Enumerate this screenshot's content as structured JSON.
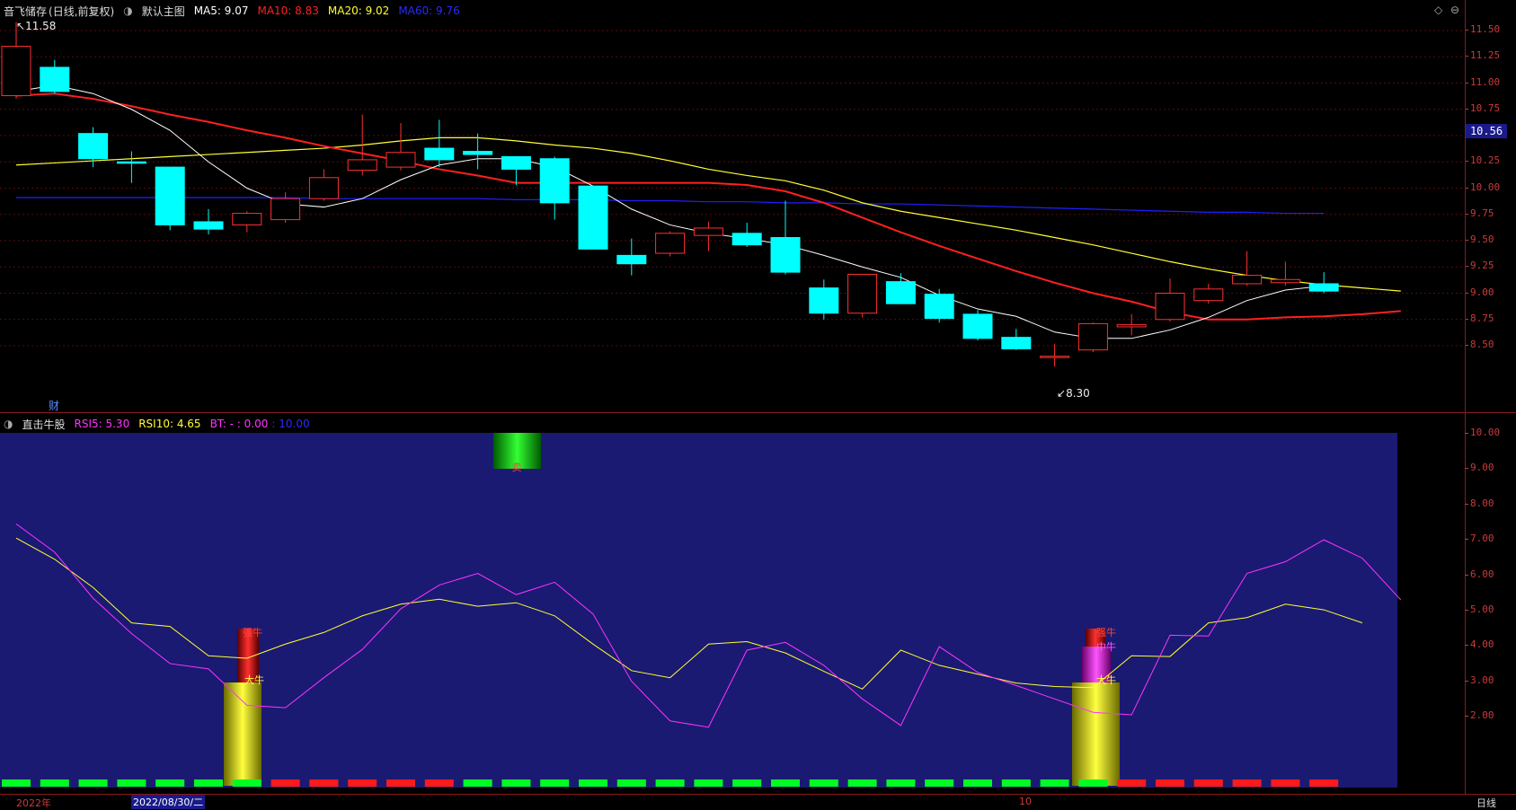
{
  "main": {
    "stock_name": "音飞储存",
    "period_mode": "(日线,前复权)",
    "chart_mode": "默认主图",
    "ma5": {
      "label": "MA5: 9.07",
      "color": "#ffffff"
    },
    "ma10": {
      "label": "MA10: 8.83",
      "color": "#ff2020"
    },
    "ma20": {
      "label": "MA20: 9.02",
      "color": "#ffff33"
    },
    "ma60": {
      "label": "MA60: 9.76",
      "color": "#2020ff"
    },
    "high_label": "11.58",
    "low_label": "8.30",
    "current_price": "10.56",
    "finance_marker": "财",
    "price_ticks": [
      "11.50",
      "11.25",
      "11.00",
      "10.75",
      "10.50",
      "10.25",
      "10.00",
      "9.75",
      "9.50",
      "9.25",
      "9.00",
      "8.75",
      "8.50"
    ]
  },
  "indicator": {
    "name": "直击牛股",
    "rsi5": {
      "label": "RSI5: 5.30",
      "color": "#ff33ff"
    },
    "rsi10": {
      "label": "RSI10: 4.65",
      "color": "#ffff33"
    },
    "bt": {
      "label": "BT: - : 0.00",
      "color": "#ff33ff"
    },
    "extra": {
      "label": ": 10.00",
      "color": "#2020ff"
    },
    "ticks": [
      "10.00",
      "9.00",
      "8.00",
      "7.00",
      "6.00",
      "5.00",
      "4.00",
      "3.00",
      "2.00"
    ],
    "signal_labels": {
      "sell": "卖",
      "strong": "强牛",
      "big": "大牛",
      "mid": "中牛"
    }
  },
  "bottom": {
    "year_label": "2022年",
    "cursor_date": "2022/08/30/二",
    "month_label": "10",
    "period_button": "日线"
  },
  "chart_data": {
    "type": "candlestick",
    "ylim": [
      8.3,
      11.6
    ],
    "candles": [
      {
        "o": 10.88,
        "h": 11.58,
        "l": 10.85,
        "c": 11.35
      },
      {
        "o": 11.15,
        "h": 11.22,
        "l": 10.9,
        "c": 10.92
      },
      {
        "o": 10.52,
        "h": 10.58,
        "l": 10.2,
        "c": 10.28
      },
      {
        "o": 10.25,
        "h": 10.35,
        "l": 10.05,
        "c": 10.24
      },
      {
        "o": 10.2,
        "h": 10.2,
        "l": 9.6,
        "c": 9.65
      },
      {
        "o": 9.68,
        "h": 9.8,
        "l": 9.56,
        "c": 9.61
      },
      {
        "o": 9.65,
        "h": 9.78,
        "l": 9.58,
        "c": 9.76
      },
      {
        "o": 9.7,
        "h": 9.96,
        "l": 9.67,
        "c": 9.9
      },
      {
        "o": 9.9,
        "h": 10.18,
        "l": 9.88,
        "c": 10.1
      },
      {
        "o": 10.17,
        "h": 10.7,
        "l": 10.12,
        "c": 10.27
      },
      {
        "o": 10.2,
        "h": 10.62,
        "l": 10.17,
        "c": 10.34
      },
      {
        "o": 10.38,
        "h": 10.65,
        "l": 10.2,
        "c": 10.27
      },
      {
        "o": 10.35,
        "h": 10.52,
        "l": 10.18,
        "c": 10.32
      },
      {
        "o": 10.3,
        "h": 10.3,
        "l": 10.03,
        "c": 10.18
      },
      {
        "o": 10.28,
        "h": 10.3,
        "l": 9.7,
        "c": 9.86
      },
      {
        "o": 10.02,
        "h": 10.02,
        "l": 9.42,
        "c": 9.42
      },
      {
        "o": 9.36,
        "h": 9.52,
        "l": 9.17,
        "c": 9.28
      },
      {
        "o": 9.38,
        "h": 9.59,
        "l": 9.35,
        "c": 9.57
      },
      {
        "o": 9.55,
        "h": 9.68,
        "l": 9.4,
        "c": 9.62
      },
      {
        "o": 9.57,
        "h": 9.67,
        "l": 9.44,
        "c": 9.46
      },
      {
        "o": 9.53,
        "h": 9.88,
        "l": 9.18,
        "c": 9.2
      },
      {
        "o": 9.05,
        "h": 9.13,
        "l": 8.75,
        "c": 8.81
      },
      {
        "o": 8.81,
        "h": 9.18,
        "l": 8.77,
        "c": 9.18
      },
      {
        "o": 9.11,
        "h": 9.19,
        "l": 8.9,
        "c": 8.9
      },
      {
        "o": 8.99,
        "h": 9.04,
        "l": 8.72,
        "c": 8.76
      },
      {
        "o": 8.8,
        "h": 8.84,
        "l": 8.55,
        "c": 8.57
      },
      {
        "o": 8.58,
        "h": 8.66,
        "l": 8.46,
        "c": 8.47
      },
      {
        "o": 8.4,
        "h": 8.52,
        "l": 8.3,
        "c": 8.4
      },
      {
        "o": 8.46,
        "h": 8.72,
        "l": 8.44,
        "c": 8.71
      },
      {
        "o": 8.68,
        "h": 8.8,
        "l": 8.6,
        "c": 8.7
      },
      {
        "o": 8.75,
        "h": 9.14,
        "l": 8.73,
        "c": 9.0
      },
      {
        "o": 8.93,
        "h": 9.09,
        "l": 8.9,
        "c": 9.04
      },
      {
        "o": 9.09,
        "h": 9.4,
        "l": 9.07,
        "c": 9.17
      },
      {
        "o": 9.1,
        "h": 9.3,
        "l": 9.07,
        "c": 9.13
      },
      {
        "o": 9.09,
        "h": 9.2,
        "l": 9.0,
        "c": 9.02
      }
    ],
    "ma5": [
      10.92,
      10.98,
      10.9,
      10.75,
      10.55,
      10.25,
      10.0,
      9.85,
      9.82,
      9.9,
      10.08,
      10.22,
      10.28,
      10.28,
      10.2,
      10.02,
      9.8,
      9.65,
      9.57,
      9.52,
      9.46,
      9.36,
      9.25,
      9.15,
      8.98,
      8.85,
      8.78,
      8.63,
      8.57,
      8.57,
      8.65,
      8.77,
      8.93,
      9.03,
      9.07
    ],
    "ma10": [
      10.88,
      10.9,
      10.85,
      10.78,
      10.7,
      10.63,
      10.55,
      10.48,
      10.4,
      10.33,
      10.26,
      10.18,
      10.12,
      10.05,
      10.05,
      10.05,
      10.05,
      10.05,
      10.05,
      10.03,
      9.97,
      9.86,
      9.72,
      9.58,
      9.45,
      9.33,
      9.21,
      9.1,
      9.0,
      8.92,
      8.82,
      8.75,
      8.75,
      8.77,
      8.78,
      8.8,
      8.83
    ],
    "ma20": [
      10.22,
      10.24,
      10.26,
      10.28,
      10.3,
      10.32,
      10.34,
      10.36,
      10.38,
      10.41,
      10.45,
      10.48,
      10.48,
      10.45,
      10.41,
      10.38,
      10.33,
      10.26,
      10.18,
      10.12,
      10.07,
      9.98,
      9.86,
      9.78,
      9.72,
      9.66,
      9.6,
      9.53,
      9.46,
      9.38,
      9.3,
      9.23,
      9.17,
      9.12,
      9.08,
      9.05,
      9.02
    ],
    "ma60": [
      9.91,
      9.91,
      9.91,
      9.91,
      9.91,
      9.91,
      9.91,
      9.91,
      9.9,
      9.9,
      9.9,
      9.9,
      9.9,
      9.89,
      9.89,
      9.89,
      9.88,
      9.88,
      9.87,
      9.87,
      9.86,
      9.86,
      9.85,
      9.85,
      9.84,
      9.83,
      9.82,
      9.81,
      9.8,
      9.79,
      9.78,
      9.77,
      9.77,
      9.76,
      9.76
    ],
    "rsi_ylim": [
      1.4,
      10.5
    ],
    "rsi5": [
      7.45,
      6.65,
      5.35,
      4.35,
      3.5,
      3.35,
      2.32,
      2.25,
      3.1,
      3.9,
      5.05,
      5.72,
      6.05,
      5.45,
      5.8,
      4.9,
      3.0,
      1.88,
      1.7,
      3.88,
      4.1,
      3.45,
      2.5,
      1.75,
      3.98,
      3.25,
      2.88,
      2.5,
      2.12,
      2.05,
      4.3,
      4.28,
      6.05,
      6.38,
      7.0,
      6.48,
      5.3
    ],
    "rsi10": [
      7.05,
      6.45,
      5.65,
      4.65,
      4.55,
      3.72,
      3.65,
      4.05,
      4.38,
      4.85,
      5.18,
      5.32,
      5.12,
      5.22,
      4.85,
      4.05,
      3.3,
      3.1,
      4.05,
      4.12,
      3.8,
      3.28,
      2.78,
      3.88,
      3.45,
      3.2,
      2.95,
      2.85,
      2.82,
      3.72,
      3.7,
      4.65,
      4.8,
      5.18,
      5.02,
      4.65
    ],
    "bottom_strip": [
      "g",
      "g",
      "g",
      "g",
      "g",
      "g",
      "g",
      "r",
      "r",
      "r",
      "r",
      "r",
      "g",
      "g",
      "g",
      "g",
      "g",
      "g",
      "g",
      "g",
      "g",
      "g",
      "g",
      "g",
      "g",
      "g",
      "g",
      "g",
      "g",
      "r",
      "r",
      "r",
      "r",
      "r",
      "r"
    ]
  }
}
